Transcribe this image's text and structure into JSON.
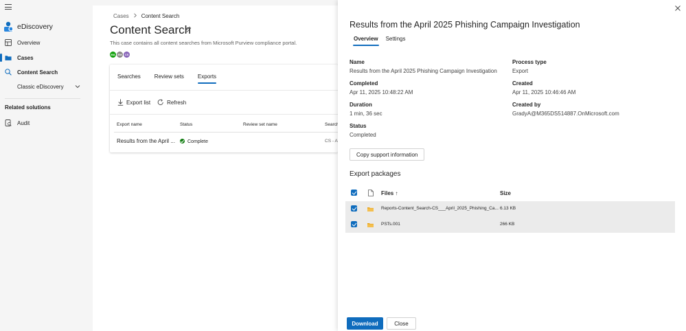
{
  "nav": {
    "app_name": "eDiscovery",
    "items": [
      {
        "label": "Overview",
        "icon": "overview-icon"
      },
      {
        "label": "Cases",
        "icon": "cases-icon"
      },
      {
        "label": "Content Search",
        "icon": "search-icon"
      }
    ],
    "sub_item": "Classic eDiscovery",
    "section": "Related solutions",
    "audit": "Audit"
  },
  "main": {
    "breadcrumb": [
      "Cases",
      "Content Search"
    ],
    "title": "Content Search",
    "description": "This case contains all content searches from Microsoft Purview compliance portal.",
    "avatars": [
      {
        "initials": "MA",
        "color": "#13a10e"
      },
      {
        "initials": "EM",
        "color": "#8a8886"
      },
      {
        "initials": "CS",
        "color": "#8764b8"
      }
    ],
    "tabs": [
      "Searches",
      "Review sets",
      "Exports"
    ],
    "active_tab": "Exports",
    "toolbar": {
      "export_list": "Export list",
      "refresh": "Refresh"
    },
    "table": {
      "headers": [
        "Export name",
        "Status",
        "Review set name",
        "Search"
      ],
      "rows": [
        {
          "name": "Results from the April ...",
          "status": "Complete",
          "review_set": "",
          "search": "CS - Ap"
        }
      ]
    }
  },
  "panel": {
    "title": "Results from the April 2025 Phishing Campaign Investigation",
    "tabs": [
      "Overview",
      "Settings"
    ],
    "fields": {
      "name_label": "Name",
      "name_value": "Results from the April 2025 Phishing Campaign Investigation",
      "completed_label": "Completed",
      "completed_value": "Apr 11, 2025 10:48:22 AM",
      "duration_label": "Duration",
      "duration_value": "1 min, 36 sec",
      "status_label": "Status",
      "status_value": "Completed",
      "process_label": "Process type",
      "process_value": "Export",
      "created_label": "Created",
      "created_value": "Apr 11, 2025 10:46:46 AM",
      "created_by_label": "Created by",
      "created_by_value": "GradyA@M365DS514887.OnMicrosoft.com"
    },
    "copy_button": "Copy support information",
    "packages_title": "Export packages",
    "packages": {
      "col_files": "Files ↑",
      "col_size": "Size",
      "items": [
        {
          "name": "Reports-Content_Search-CS___April_2025_Phishing_Ca...",
          "size": "6.13 KB"
        },
        {
          "name": "PSTs.001",
          "size": "266 KB"
        }
      ]
    },
    "download_button": "Download",
    "close_button": "Close"
  },
  "colors": {
    "accent": "#0f6cbd",
    "status_ok": "#107c10"
  }
}
